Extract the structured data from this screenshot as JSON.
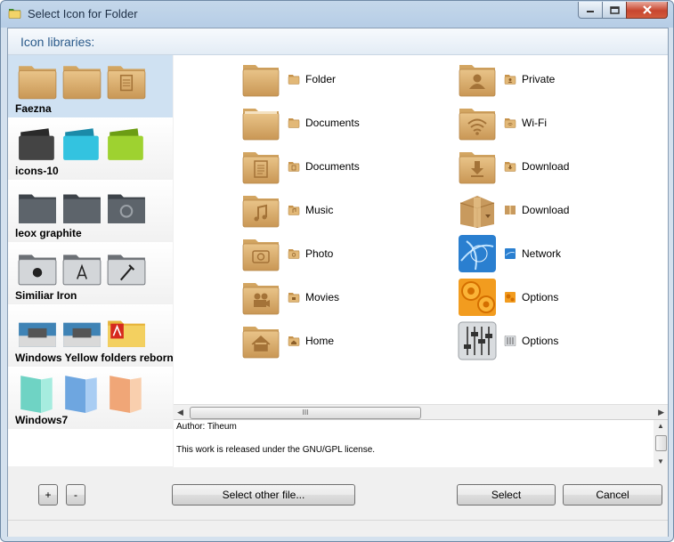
{
  "window": {
    "title": "Select Icon for Folder",
    "title_icon": "folder-app-icon",
    "controls": [
      "minimize-icon",
      "maximize-icon",
      "close-icon"
    ]
  },
  "libraries_header": "Icon libraries:",
  "libraries": [
    {
      "name": "Faezna",
      "selected": true,
      "icons": [
        "folder-icon",
        "folder-icon",
        "document-folder-icon"
      ]
    },
    {
      "name": "icons-10",
      "selected": false,
      "icons": [
        "black-folder-icon",
        "cyan-folder-icon",
        "green-folder-icon"
      ]
    },
    {
      "name": "leox graphite",
      "selected": false,
      "icons": [
        "graphite-folder-icon",
        "graphite-folder-icon",
        "graphite-camera-folder-icon"
      ]
    },
    {
      "name": "Similiar Iron",
      "selected": false,
      "icons": [
        "apple-folder-icon",
        "appstore-folder-icon",
        "hammer-folder-icon"
      ]
    },
    {
      "name": "Windows Yellow folders reborn",
      "selected": false,
      "icons": [
        "printer-folder-icon",
        "printer-folder-icon",
        "adobe-folder-icon"
      ]
    },
    {
      "name": "Windows7",
      "selected": false,
      "icons": [
        "teal-folder-icon",
        "blue-folder-icon",
        "orange-folder-icon"
      ]
    }
  ],
  "icons_left": [
    {
      "label": "Folder",
      "icon": "folder-icon"
    },
    {
      "label": "Documents",
      "icon": "folder-icon"
    },
    {
      "label": "Documents",
      "icon": "document-folder-icon"
    },
    {
      "label": "Music",
      "icon": "music-folder-icon"
    },
    {
      "label": "Photo",
      "icon": "photo-folder-icon"
    },
    {
      "label": "Movies",
      "icon": "movies-folder-icon"
    },
    {
      "label": "Home",
      "icon": "home-folder-icon"
    }
  ],
  "icons_right": [
    {
      "label": "Private",
      "icon": "private-folder-icon"
    },
    {
      "label": "Wi-Fi",
      "icon": "wifi-folder-icon"
    },
    {
      "label": "Download",
      "icon": "download-folder-icon"
    },
    {
      "label": "Download",
      "icon": "download-box-icon"
    },
    {
      "label": "Network",
      "icon": "network-icon"
    },
    {
      "label": "Options",
      "icon": "options-gears-icon"
    },
    {
      "label": "Options",
      "icon": "options-sliders-icon"
    }
  ],
  "info": {
    "author": "Author: Tiheum",
    "license": "This work is released under the GNU/GPL license."
  },
  "scroll_grip": "III",
  "buttons": {
    "add": "+",
    "remove": "-",
    "select_other": "Select other file...",
    "select": "Select",
    "cancel": "Cancel"
  },
  "colors": {
    "folder_tan": "#d9ac6a",
    "selection_blue": "#cfe1f2",
    "header_text": "#2a5a8a"
  }
}
